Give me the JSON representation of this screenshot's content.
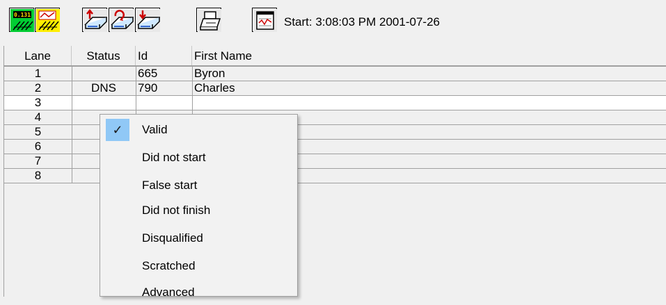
{
  "toolbar": {
    "buttons": [
      {
        "name": "timing-display-icon",
        "badge": "0.131"
      },
      {
        "name": "results-chart-icon"
      },
      {
        "name": "upload-icon"
      },
      {
        "name": "refresh-icon"
      },
      {
        "name": "download-icon"
      },
      {
        "name": "print-icon"
      },
      {
        "name": "graph-window-icon"
      }
    ],
    "start_label": "Start:  3:08:03 PM 2001-07-26"
  },
  "grid": {
    "columns": [
      "Lane",
      "Status",
      "Id",
      "First Name"
    ],
    "rows": [
      {
        "lane": "1",
        "status": "",
        "id": "665",
        "first_name": "Byron"
      },
      {
        "lane": "2",
        "status": "DNS",
        "id": "790",
        "first_name": "Charles"
      },
      {
        "lane": "3",
        "status": "",
        "id": "",
        "first_name": ""
      },
      {
        "lane": "4",
        "status": "",
        "id": "",
        "first_name": ""
      },
      {
        "lane": "5",
        "status": "",
        "id": "",
        "first_name": ""
      },
      {
        "lane": "6",
        "status": "",
        "id": "",
        "first_name": ""
      },
      {
        "lane": "7",
        "status": "",
        "id": "",
        "first_name": ""
      },
      {
        "lane": "8",
        "status": "",
        "id": "",
        "first_name": ""
      }
    ],
    "selected_row": 2
  },
  "context_menu": {
    "items": [
      {
        "label": "Valid",
        "checked": true
      },
      {
        "label": "Did not start",
        "checked": false
      },
      {
        "label": "False start",
        "checked": false
      },
      {
        "label": "Did not finish",
        "checked": false
      },
      {
        "label": "Disqualified",
        "checked": false
      },
      {
        "label": "Scratched",
        "checked": false
      },
      {
        "label": "Advanced",
        "checked": false
      }
    ],
    "check_glyph": "✓",
    "highlight_color": "#90c8f6"
  },
  "colors": {
    "background": "#f0f0f0",
    "selected_row": "#ffffff",
    "gridline": "#a0a0a0"
  }
}
